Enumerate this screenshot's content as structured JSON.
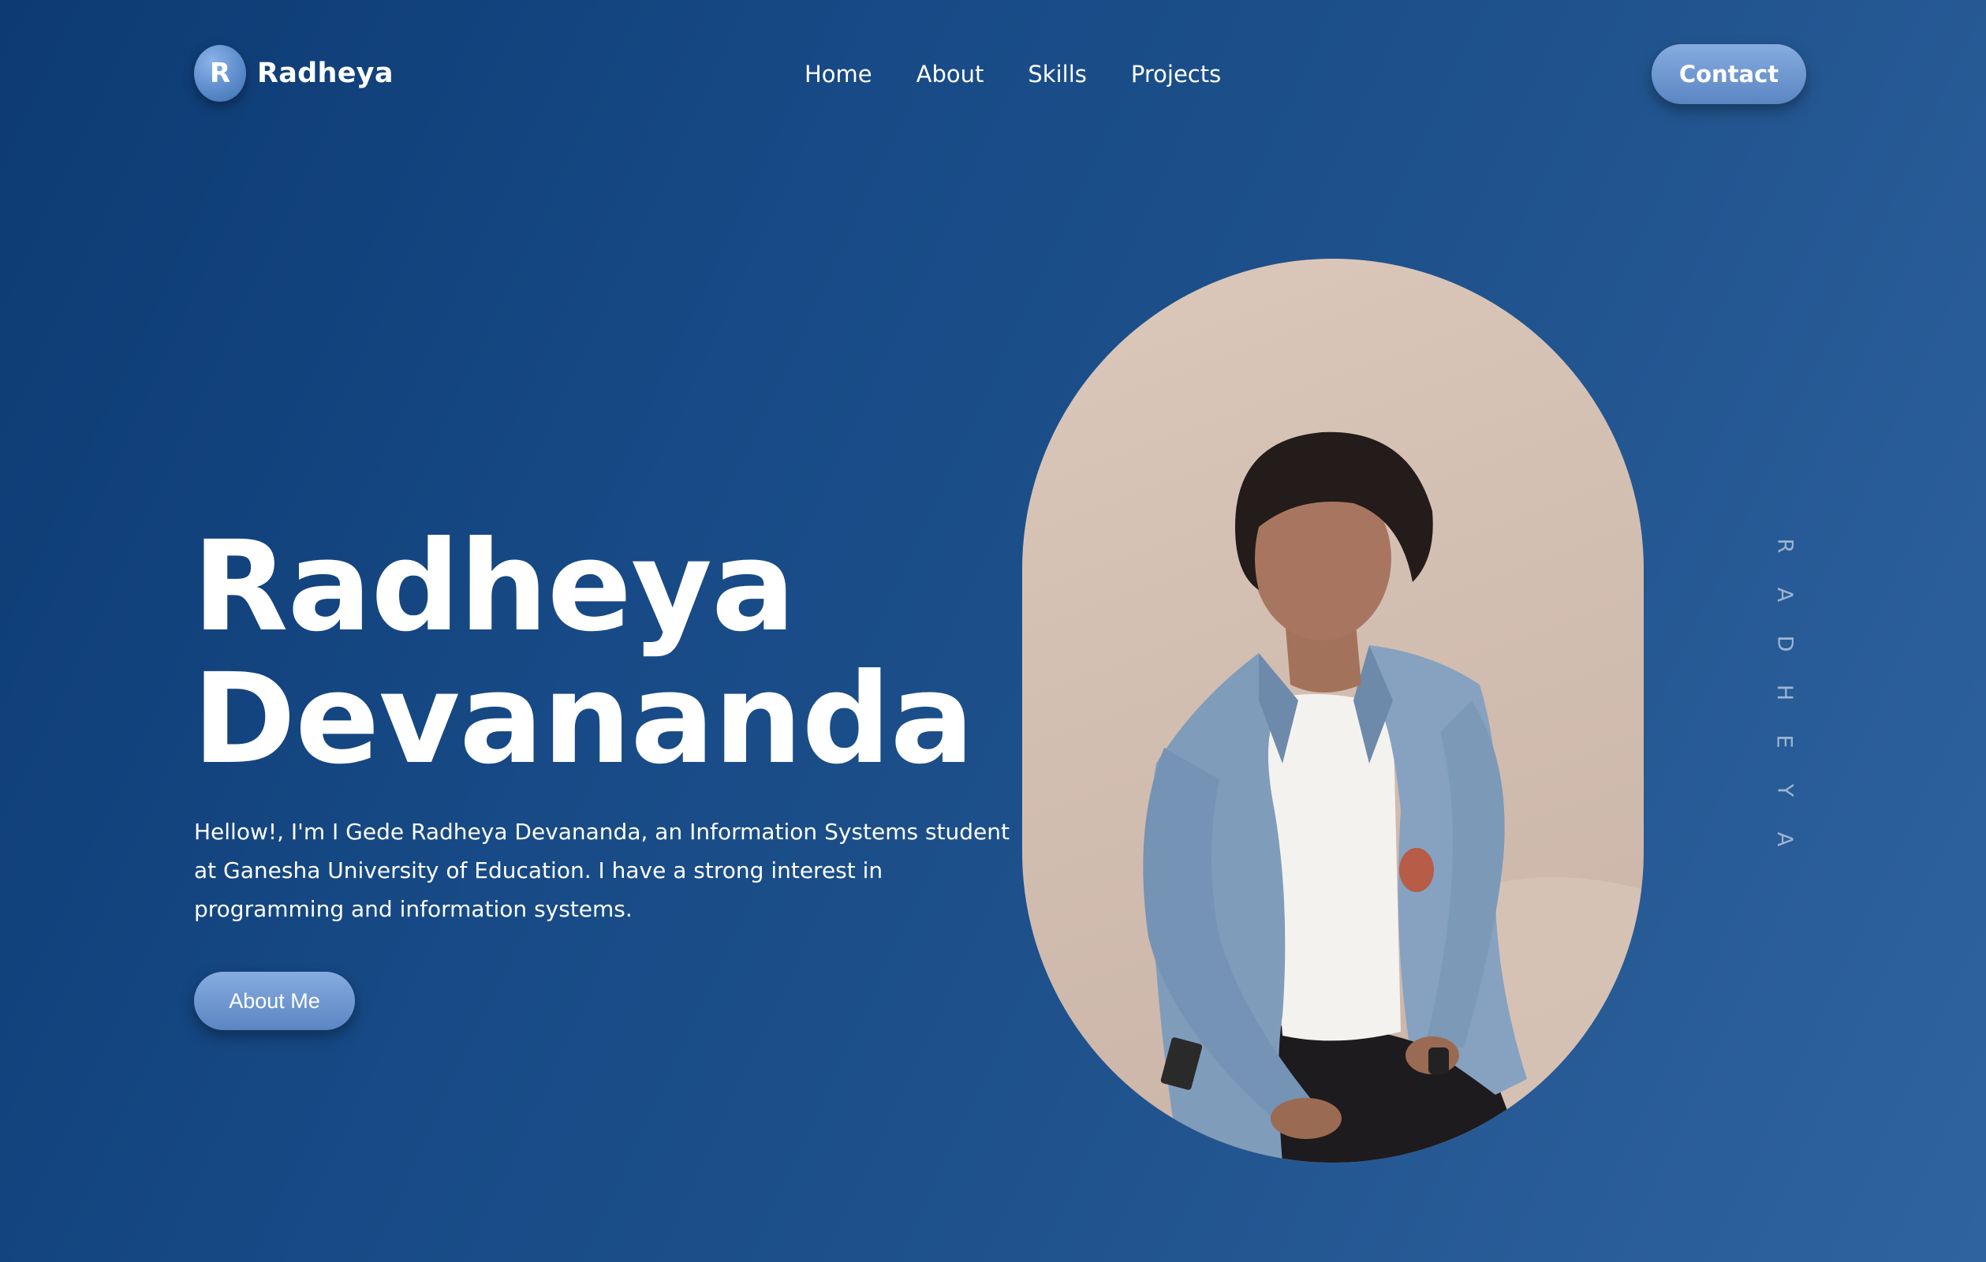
{
  "nav": {
    "logo_letter": "R",
    "logo_name": "Radheya",
    "links": [
      "Home",
      "About",
      "Skills",
      "Projects"
    ],
    "contact_label": "Contact"
  },
  "hero": {
    "title_line1": "Radheya",
    "title_line2": "Devananda",
    "description": "Hellow!, I'm I Gede Radheya Devananda, an Information Systems student at Ganesha University of Education. I have a strong interest in programming and information systems.",
    "about_button": "About Me",
    "vertical_letters": [
      "R",
      "A",
      "D",
      "H",
      "E",
      "Y",
      "A"
    ]
  },
  "colors": {
    "background_start": "#0d3a72",
    "background_end": "#2f63a0",
    "button": "#6f97d1",
    "text": "#ffffff"
  }
}
